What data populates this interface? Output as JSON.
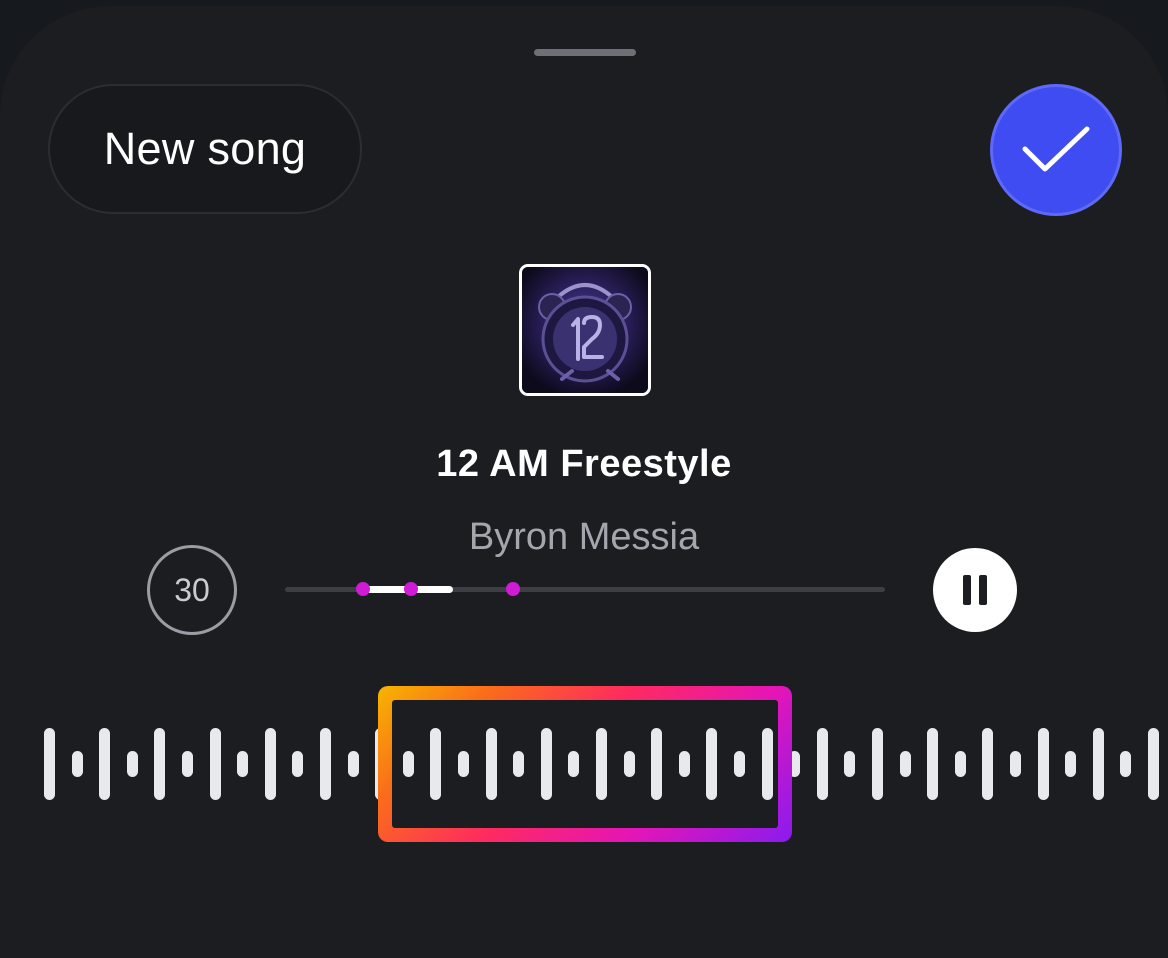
{
  "header": {
    "new_song_label": "New song",
    "done_icon": "checkmark-icon",
    "accent_color": "#3f4cf2"
  },
  "track": {
    "title": "12 AM Freestyle",
    "artist": "Byron Messia",
    "artwork_icon": "album-artwork"
  },
  "player": {
    "duration_label": "30",
    "playback_state": "playing",
    "pause_icon": "pause-icon",
    "selection_start_fraction": 0.13,
    "selection_end_fraction": 0.28,
    "marker_fractions": [
      0.13,
      0.21,
      0.38
    ],
    "marker_color": "#cf1ad6"
  },
  "waveform": {
    "bar_heights": [
      1,
      0.6,
      1,
      0.6,
      1,
      0.6,
      1,
      0.6,
      1,
      0.6,
      1,
      0.6,
      1,
      0.6,
      1,
      0.6,
      1,
      0.6,
      1,
      0.6,
      1,
      0.6,
      1,
      0.6,
      1,
      0.6,
      1,
      0.6,
      1,
      0.6,
      1,
      0.6,
      1,
      0.6,
      1,
      0.6,
      1,
      0.6,
      1,
      0.6,
      1,
      0.6
    ],
    "selection_gradient": [
      "#f7b500",
      "#fa6d1a",
      "#ff2a5f",
      "#e615b5",
      "#8a1bf0"
    ]
  }
}
